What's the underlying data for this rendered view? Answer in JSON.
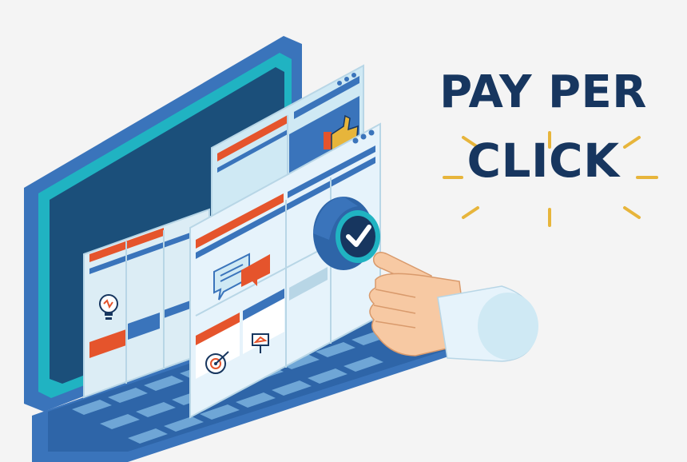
{
  "headline": {
    "line1": "PAY PER",
    "line2": "CLICK"
  },
  "colors": {
    "navy": "#17365f",
    "laptop_blue": "#3a74bb",
    "screen_dark": "#1b4f7a",
    "teal": "#20b3c2",
    "panel_light": "#cfe9f4",
    "accent_orange": "#e5542c",
    "accent_gold": "#e7b53b",
    "skin": "#f7c9a3",
    "cuff": "#e6f3fb"
  },
  "icons": [
    "laptop-icon",
    "lightbulb-icon",
    "chat-bubbles-icon",
    "target-icon",
    "presentation-icon",
    "thumbs-up-icon",
    "checkmark-button-icon",
    "pointing-hand-icon"
  ]
}
